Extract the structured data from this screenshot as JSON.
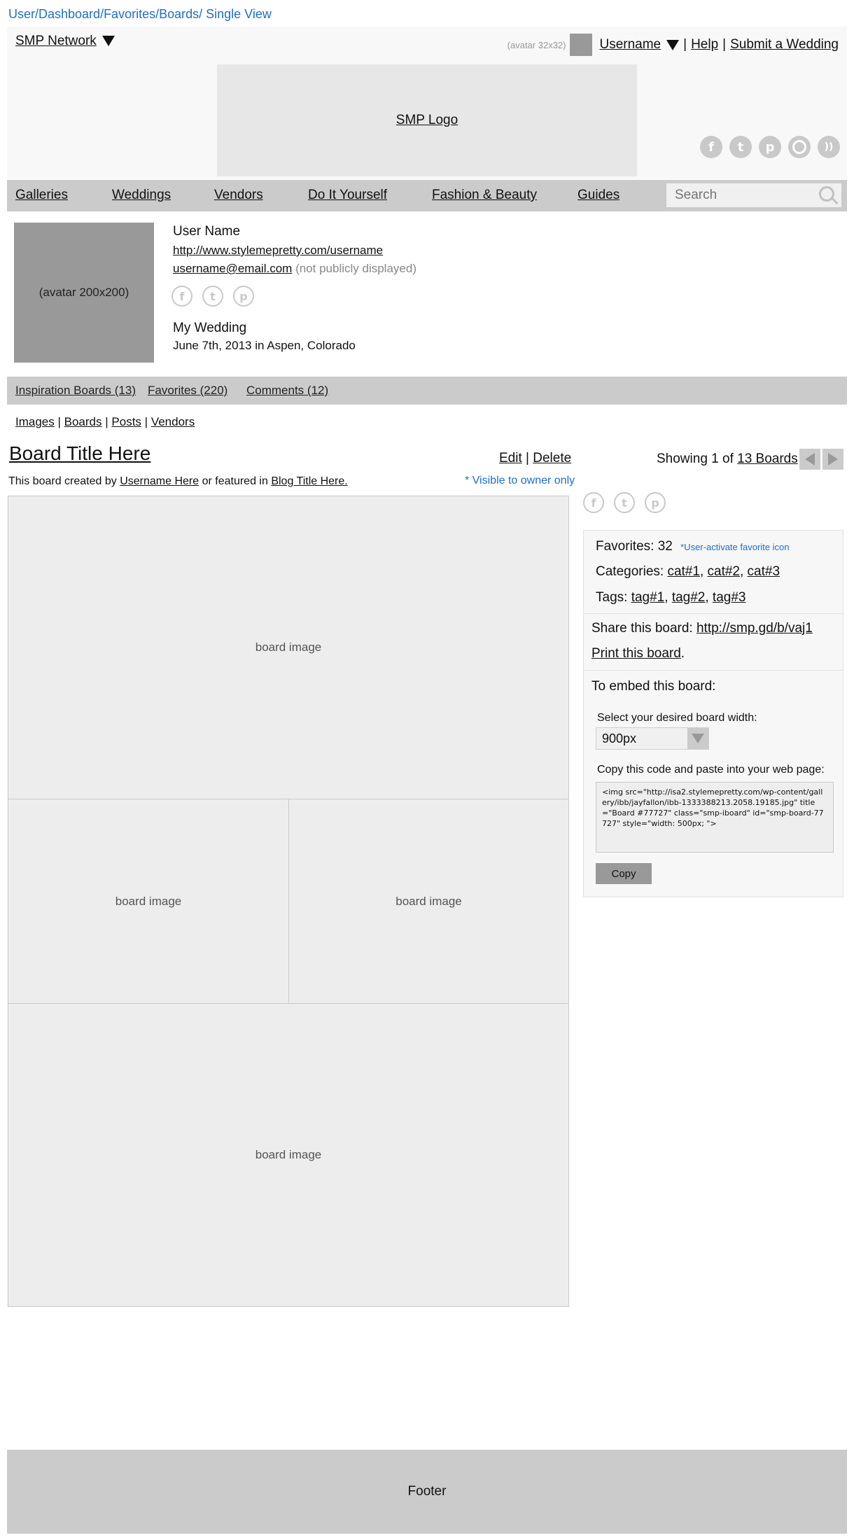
{
  "breadcrumb": "User/Dashboard/Favorites/Boards/ Single View",
  "header": {
    "network": "SMP Network",
    "avatar_small_label": "(avatar 32x32)",
    "username": "Username",
    "sep1": "|",
    "help": "Help",
    "sep2": "|",
    "submit": "Submit a Wedding",
    "logo": "SMP Logo",
    "social_icons": [
      "facebook-icon",
      "twitter-icon",
      "pinterest-icon",
      "instagram-icon",
      "rss-icon"
    ]
  },
  "nav": {
    "items": [
      "Galleries",
      "Weddings",
      "Vendors",
      "Do It Yourself",
      "Fashion & Beauty",
      "Guides"
    ],
    "search_placeholder": "Search"
  },
  "profile": {
    "avatar_label": "(avatar 200x200)",
    "name": "User Name",
    "url": "http://www.stylemepretty.com/username",
    "email": "username@email.com",
    "email_note": "(not publicly displayed)",
    "social_icons": [
      "facebook-icon",
      "twitter-icon",
      "pinterest-icon"
    ],
    "wedding_title": "My Wedding",
    "wedding_details": "June 7th, 2013 in Aspen, Colorado"
  },
  "tabs": [
    "Inspiration Boards (13)",
    "Favorites (220)",
    "Comments (12)"
  ],
  "subnav": [
    "Images",
    "Boards",
    "Posts",
    "Vendors"
  ],
  "subnav_sep": "|",
  "board": {
    "title": "Board Title Here",
    "edit": "Edit",
    "sep": "|",
    "delete": "Delete",
    "showing_prefix": "Showing 1 of",
    "showing_link": "13 Boards",
    "created_prefix": "This board created by",
    "created_user": "Username Here",
    "created_mid": "or featured in",
    "created_blog": "Blog Title Here.",
    "visible_note": "* Visible to owner only",
    "image_label": "board image"
  },
  "panel": {
    "social_icons": [
      "facebook-icon",
      "twitter-icon",
      "pinterest-icon"
    ],
    "favorites_label": "Favorites:",
    "favorites_count": "32",
    "favorites_note": "*User-activate favorite icon",
    "categories_label": "Categories:",
    "categories": [
      "cat#1",
      "cat#2",
      "cat#3"
    ],
    "tags_label": "Tags:",
    "tags": [
      "tag#1",
      "tag#2",
      "tag#3"
    ],
    "share_label": "Share this board:",
    "share_link": "http://smp.gd/b/vaj1",
    "print_link": "Print this board",
    "print_after": ".",
    "embed_title": "To embed this board:",
    "width_label": "Select your desired board width:",
    "width_value": "900px",
    "code_label": "Copy this code and paste into your web page:",
    "code": "<img src=\"http://isa2.stylemepretty.com/wp-content/gallery/ibb/jayfallon/ibb-1333388213.2058.19185.jpg\" title=\"Board #77727\" class=\"smp-iboard\" id=\"smp-board-77727\" style=\"width: 500px; \">",
    "copy_button": "Copy"
  },
  "footer": "Footer"
}
